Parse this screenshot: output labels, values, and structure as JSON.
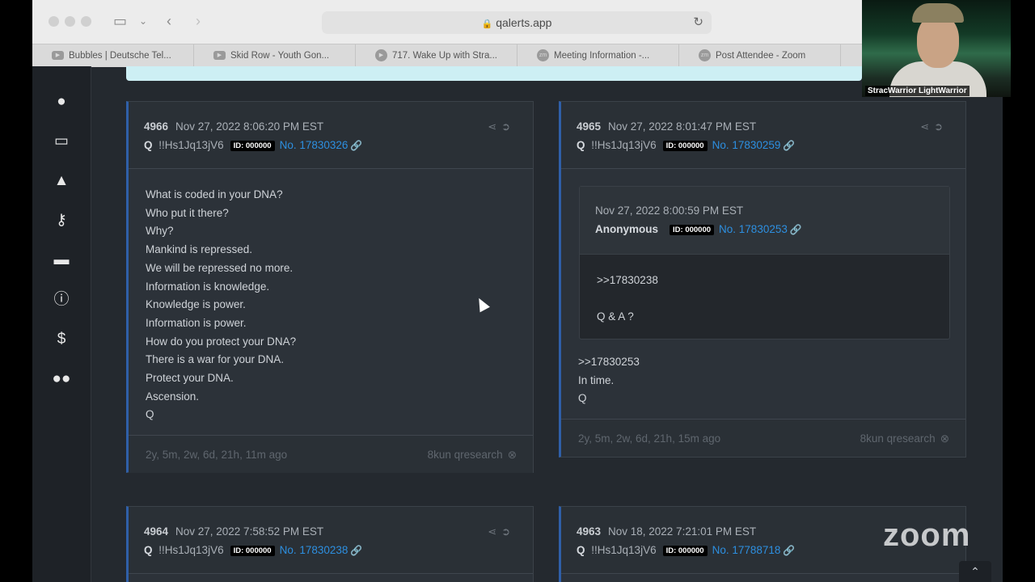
{
  "browser": {
    "url": "qalerts.app",
    "tabs": [
      {
        "label": "Bubbles | Deutsche Tel..."
      },
      {
        "label": "Skid Row - Youth Gon..."
      },
      {
        "label": "717. Wake Up with Stra..."
      },
      {
        "label": "Meeting Information -..."
      },
      {
        "label": "Post Attendee - Zoom"
      }
    ]
  },
  "webcam": {
    "name": "StracWarrior LightWarrior"
  },
  "zoom": {
    "logo": "zoom"
  },
  "posts": [
    {
      "num": "4966",
      "date": "Nov 27, 2022 8:06:20 PM EST",
      "author": "Q",
      "trip": "!!Hs1Jq13jV6",
      "id": "ID: 000000",
      "post_no": "No. 17830326",
      "lines": [
        "What is coded in your DNA?",
        "Who put it there?",
        "Why?",
        "Mankind is repressed.",
        "We will be repressed no more.",
        "Information is knowledge.",
        "Knowledge is power.",
        "Information is power.",
        "How do you protect your DNA?",
        "There is a war for your DNA.",
        "Protect your DNA.",
        "Ascension.",
        "Q"
      ],
      "ago": "2y, 5m, 2w, 6d, 21h, 11m ago",
      "source": "8kun qresearch"
    },
    {
      "num": "4965",
      "date": "Nov 27, 2022 8:01:47 PM EST",
      "author": "Q",
      "trip": "!!Hs1Jq13jV6",
      "id": "ID: 000000",
      "post_no": "No. 17830259",
      "quote": {
        "date": "Nov 27, 2022 8:00:59 PM EST",
        "author": "Anonymous",
        "id": "ID: 000000",
        "post_no": "No. 17830253",
        "line1": ">>17830238",
        "line2": "Q & A ?"
      },
      "lines": [
        ">>17830253",
        "In time.",
        "Q"
      ],
      "ago": "2y, 5m, 2w, 6d, 21h, 15m ago",
      "source": "8kun qresearch"
    },
    {
      "num": "4964",
      "date": "Nov 27, 2022 7:58:52 PM EST",
      "author": "Q",
      "trip": "!!Hs1Jq13jV6",
      "id": "ID: 000000",
      "post_no": "No. 17830238"
    },
    {
      "num": "4963",
      "date": "Nov 18, 2022 7:21:01 PM EST",
      "author": "Q",
      "trip": "!!Hs1Jq13jV6",
      "id": "ID: 000000",
      "post_no": "No. 17788718"
    }
  ]
}
